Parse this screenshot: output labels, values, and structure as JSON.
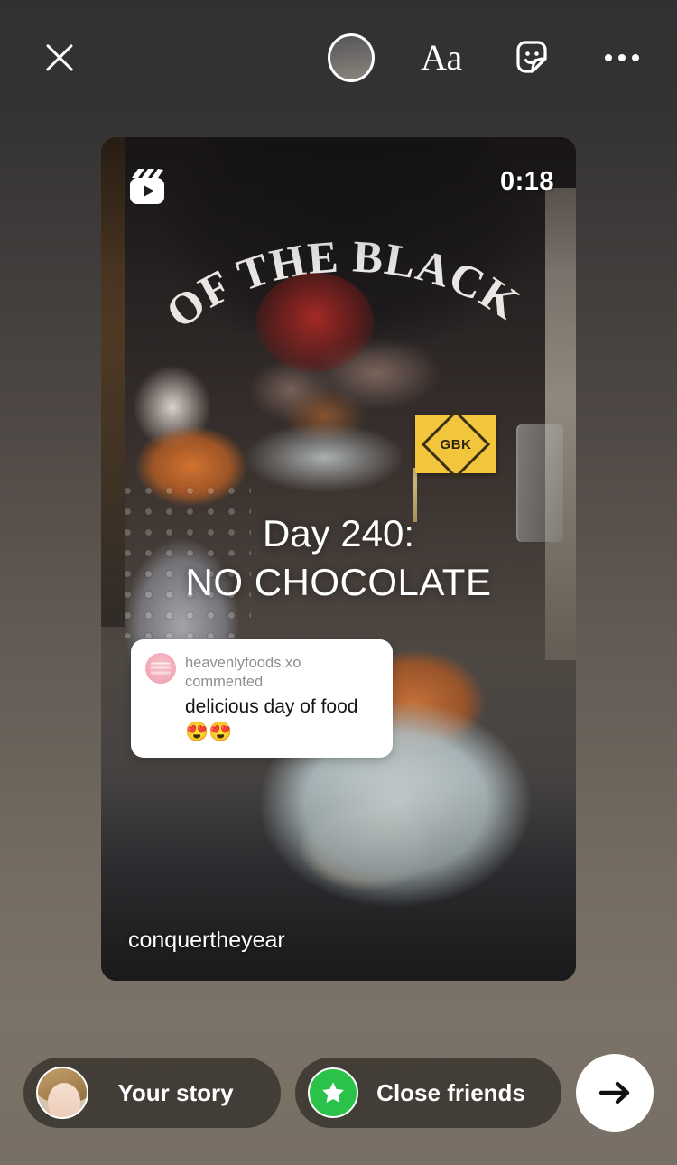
{
  "screen": {
    "name": "instagram-story-editor",
    "background_top_color": "#313133",
    "background_bottom_color": "#7b7268"
  },
  "toolbar": {
    "close_label": "Close",
    "close_icon": "close-x-icon",
    "tools": [
      {
        "id": "brush",
        "label": "Draw",
        "icon": "brush-circle-icon"
      },
      {
        "id": "text",
        "label": "Aa",
        "icon": "text-aa-icon"
      },
      {
        "id": "sticker",
        "label": "Stickers",
        "icon": "sticker-smiley-icon"
      },
      {
        "id": "more",
        "label": "More options",
        "icon": "three-dots-icon"
      }
    ]
  },
  "media": {
    "type": "reel-video",
    "reels_icon": "reels-clapperboard-icon",
    "duration": "0:18",
    "username": "conquertheyear",
    "flag_label": "GBK",
    "shirt_text": "OF THE BLACK",
    "overlay_text": {
      "line1": "Day 240:",
      "line2": "NO CHOCOLATE"
    },
    "comment_sticker": {
      "header": "heavenlyfoods.xo commented",
      "body": "delicious day of food 😍😍",
      "avatar": "commenter-avatar"
    }
  },
  "bottombar": {
    "your_story": {
      "label": "Your story",
      "avatar": "user-profile-avatar"
    },
    "close_friends": {
      "label": "Close friends",
      "badge_icon": "green-star-badge-icon",
      "badge_color": "#2bc24a"
    },
    "send": {
      "label": "Send",
      "icon": "arrow-right-icon"
    }
  }
}
